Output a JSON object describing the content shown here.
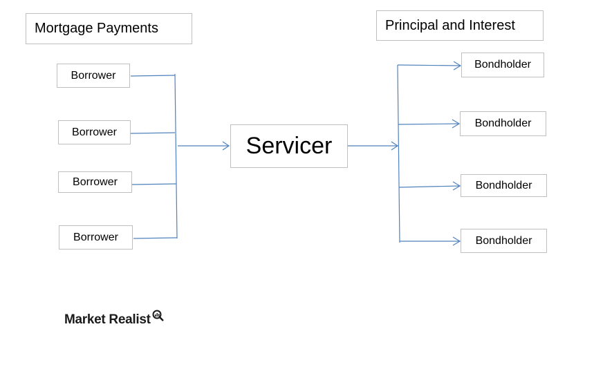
{
  "diagram": {
    "left_title": "Mortgage Payments",
    "right_title": "Principal and Interest",
    "center_node": "Servicer",
    "borrowers": [
      "Borrower",
      "Borrower",
      "Borrower",
      "Borrower"
    ],
    "bondholders": [
      "Bondholder",
      "Bondholder",
      "Bondholder",
      "Bondholder"
    ],
    "flow": [
      {
        "from": "Borrower",
        "to": "Servicer",
        "label": "Mortgage Payments"
      },
      {
        "from": "Servicer",
        "to": "Bondholder",
        "label": "Principal and Interest"
      }
    ],
    "colors": {
      "connector": "#4f81bd",
      "box_border": "#bfbfbf"
    }
  },
  "branding": {
    "logo_text": "Market Realist",
    "logo_icon": "magnifier-chart-icon"
  }
}
